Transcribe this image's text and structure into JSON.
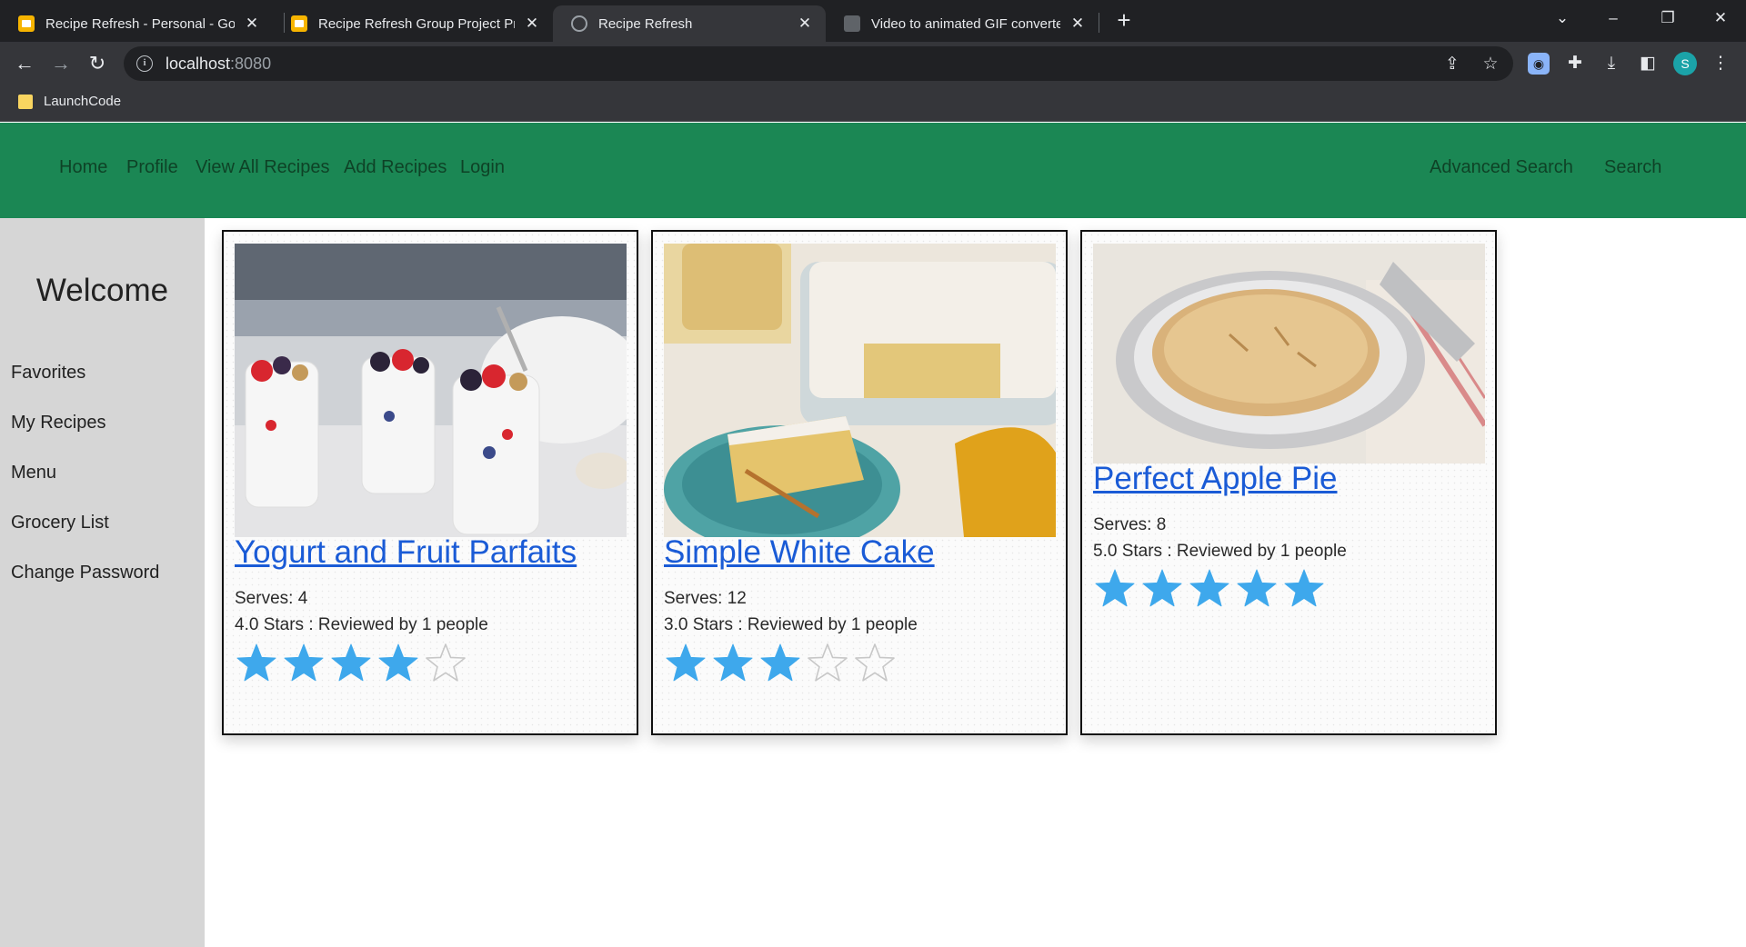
{
  "browser": {
    "tabs": [
      {
        "title": "Recipe Refresh - Personal - Goog",
        "icon": "slides-icon",
        "active": false
      },
      {
        "title": "Recipe Refresh Group Project Pre",
        "icon": "slides-icon",
        "active": false
      },
      {
        "title": "Recipe Refresh",
        "icon": "globe-icon",
        "active": true
      },
      {
        "title": "Video to animated GIF converter",
        "icon": "gif-icon",
        "active": false
      }
    ],
    "url_host": "localhost",
    "url_port": ":8080",
    "bookmark": "LaunchCode",
    "profile_initial": "S"
  },
  "nav": {
    "home": "Home",
    "profile": "Profile",
    "view_all": "View All Recipes",
    "add": "Add Recipes",
    "login": "Login",
    "advanced_search": "Advanced Search",
    "search": "Search"
  },
  "sidebar": {
    "welcome": "Welcome",
    "items": [
      "Favorites",
      "My Recipes",
      "Menu",
      "Grocery List",
      "Change Password"
    ]
  },
  "recipes": [
    {
      "title": "Yogurt and Fruit Parfaits",
      "serves": "Serves: 4",
      "rating_text": "4.0 Stars : Reviewed by 1 people",
      "stars": 4,
      "max_stars": 5
    },
    {
      "title": "Simple White Cake",
      "serves": "Serves: 12",
      "rating_text": "3.0 Stars : Reviewed by 1 people",
      "stars": 3,
      "max_stars": 5
    },
    {
      "title": "Perfect Apple Pie",
      "serves": "Serves: 8",
      "rating_text": "5.0 Stars : Reviewed by 1 people",
      "stars": 5,
      "max_stars": 5
    }
  ],
  "colors": {
    "nav_green": "#1b8754",
    "sidebar_gray": "#d6d6d6",
    "link_blue": "#1a5bd6",
    "star_blue": "#3ea8ec"
  }
}
